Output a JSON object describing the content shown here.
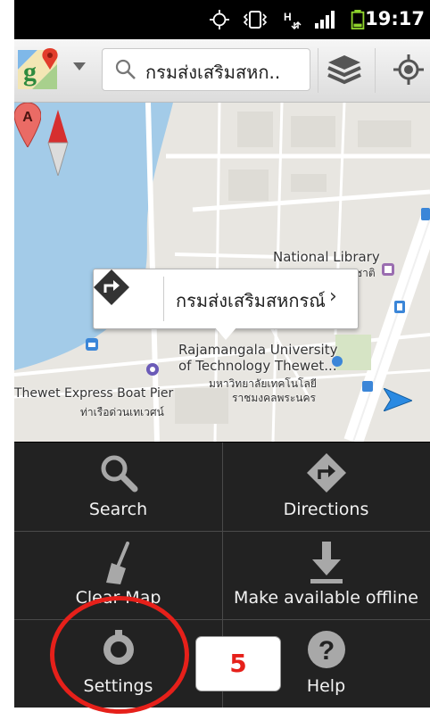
{
  "status_bar": {
    "time": "19:17",
    "icons": [
      "gps-icon",
      "vibrate-icon",
      "data-h-icon",
      "signal-icon",
      "battery-icon"
    ]
  },
  "action_bar": {
    "search_text": "กรมส่งเสริมสหก..",
    "icons": [
      "google-maps-logo-icon",
      "layers-icon",
      "my-location-icon"
    ]
  },
  "map": {
    "labels": {
      "national_library": "National Library",
      "national_library_th": "ชาติ",
      "university_line1": "Rajamangala University",
      "university_line2": "of Technology Thewet...",
      "university_th1": "มหาวิทยาลัยเทคโนโลยี",
      "university_th2": "ราชมงคลพระนคร",
      "pier": "Thewet Express Boat Pier",
      "pier_th": "ท่าเรือด่วนเทเวศน์"
    },
    "callout": {
      "title": "กรมส่งเสริมสหกรณ์",
      "chevron": "›"
    },
    "marker_letter": "A"
  },
  "menu": {
    "items": [
      {
        "label": "Search",
        "icon": "search-icon"
      },
      {
        "label": "Directions",
        "icon": "directions-icon"
      },
      {
        "label": "Clear Map",
        "icon": "broom-icon"
      },
      {
        "label": "Make available offline",
        "icon": "download-icon"
      },
      {
        "label": "Settings",
        "icon": "settings-icon"
      },
      {
        "label": "Help",
        "icon": "help-icon"
      }
    ]
  },
  "annotation": {
    "step_number": "5",
    "color": "#e6201a"
  }
}
